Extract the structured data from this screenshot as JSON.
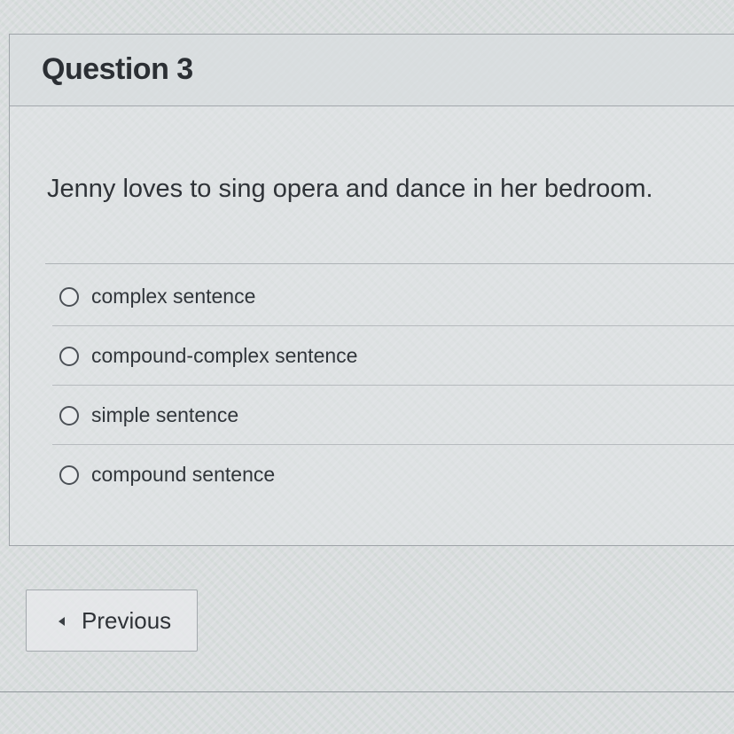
{
  "question": {
    "title": "Question 3",
    "text": "Jenny loves to sing opera and dance in her bedroom.",
    "options": [
      {
        "label": "complex sentence",
        "selected": false
      },
      {
        "label": "compound-complex sentence",
        "selected": false
      },
      {
        "label": "simple sentence",
        "selected": false
      },
      {
        "label": "compound sentence",
        "selected": false
      }
    ]
  },
  "navigation": {
    "previous_label": "Previous",
    "previous_icon": "chevron-left-icon"
  }
}
